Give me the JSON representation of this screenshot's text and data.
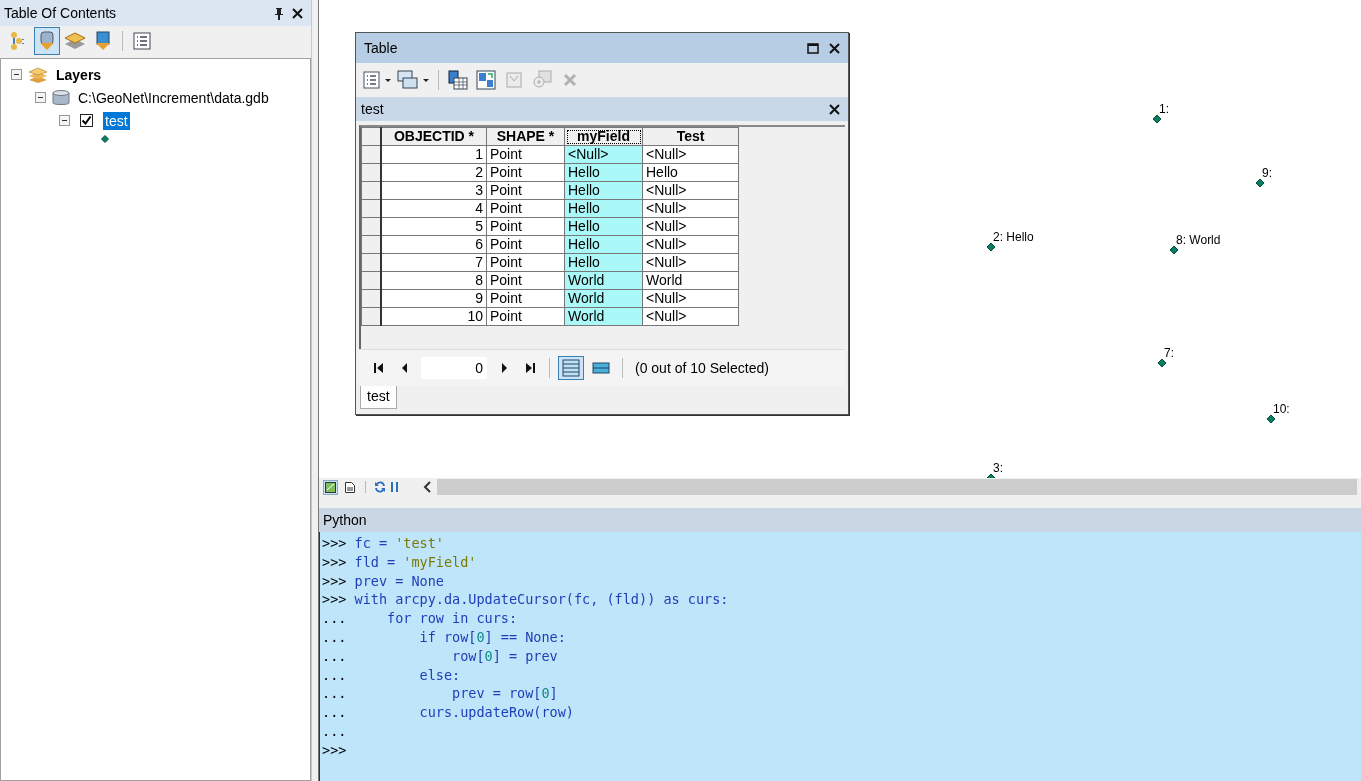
{
  "toc": {
    "title": "Table Of Contents",
    "toolbar": [
      {
        "kind": "drawing-order",
        "selected": false
      },
      {
        "kind": "source",
        "selected": true
      },
      {
        "kind": "visibility",
        "selected": false
      },
      {
        "kind": "selection",
        "selected": false
      },
      {
        "kind": "options",
        "selected": false
      }
    ],
    "tree": [
      {
        "label": "Layers",
        "kind": "frame",
        "expanded": true,
        "children": [
          {
            "label": "C:\\GeoNet\\Increment\\data.gdb",
            "kind": "database",
            "expanded": true,
            "children": [
              {
                "label": "test",
                "kind": "layer",
                "expanded": true,
                "checked": true,
                "selected": true
              }
            ]
          }
        ]
      }
    ]
  },
  "map": {
    "points": [
      {
        "label": "1:"
      },
      {
        "label": "9:"
      },
      {
        "label": "2: Hello"
      },
      {
        "label": "8: World"
      },
      {
        "label": "7:"
      },
      {
        "label": "10:"
      },
      {
        "label": "3:"
      }
    ]
  },
  "table_window": {
    "title": "Table",
    "toolbar": [
      {
        "kind": "options",
        "disabled": false
      },
      {
        "kind": "related",
        "disabled": false
      },
      {
        "kind": "select-by-attributes",
        "disabled": false
      },
      {
        "kind": "switch-selection",
        "disabled": false
      },
      {
        "kind": "clear-selection",
        "disabled": true
      },
      {
        "kind": "zoom-selected",
        "disabled": true
      },
      {
        "kind": "delete",
        "disabled": true
      }
    ],
    "table_name": "test",
    "columns": [
      {
        "label": "OBJECTID *",
        "kind": "number",
        "selected": false
      },
      {
        "label": "SHAPE *",
        "kind": "text",
        "selected": false
      },
      {
        "label": "myField",
        "kind": "text",
        "selected": true
      },
      {
        "label": "Test",
        "kind": "text",
        "selected": false
      }
    ],
    "rows": [
      [
        "1",
        "Point",
        "<Null>",
        "<Null>"
      ],
      [
        "2",
        "Point",
        "Hello",
        "Hello"
      ],
      [
        "3",
        "Point",
        "Hello",
        "<Null>"
      ],
      [
        "4",
        "Point",
        "Hello",
        "<Null>"
      ],
      [
        "5",
        "Point",
        "Hello",
        "<Null>"
      ],
      [
        "6",
        "Point",
        "Hello",
        "<Null>"
      ],
      [
        "7",
        "Point",
        "Hello",
        "<Null>"
      ],
      [
        "8",
        "Point",
        "World",
        "World"
      ],
      [
        "9",
        "Point",
        "World",
        "<Null>"
      ],
      [
        "10",
        "Point",
        "World",
        "<Null>"
      ]
    ],
    "record": "0",
    "views": [
      {
        "kind": "all-records",
        "selected": true
      },
      {
        "kind": "selected-records",
        "selected": false
      }
    ],
    "status": "(0 out of 10 Selected)",
    "tabs": [
      {
        "label": "test",
        "selected": true
      }
    ]
  },
  "map_toolbar": {
    "views": [
      {
        "kind": "layout",
        "selected": true
      },
      {
        "kind": "page",
        "selected": false
      }
    ]
  },
  "python": {
    "title": "Python",
    "lines": [
      {
        "prompt": ">>>",
        "tokens": [
          {
            "kind": "code",
            "text": "fc = "
          },
          {
            "kind": "string",
            "text": "'test'"
          }
        ]
      },
      {
        "prompt": ">>>",
        "tokens": [
          {
            "kind": "code",
            "text": "fld = "
          },
          {
            "kind": "string",
            "text": "'myField'"
          }
        ]
      },
      {
        "prompt": ">>>",
        "tokens": [
          {
            "kind": "code",
            "text": "prev = None"
          }
        ]
      },
      {
        "prompt": ">>>",
        "tokens": [
          {
            "kind": "code",
            "text": "with arcpy.da.UpdateCursor(fc, (fld)) as curs:"
          }
        ]
      },
      {
        "prompt": "...",
        "tokens": [
          {
            "kind": "code",
            "text": "    for row in curs:"
          }
        ]
      },
      {
        "prompt": "...",
        "tokens": [
          {
            "kind": "code",
            "text": "        if row["
          },
          {
            "kind": "number",
            "text": "0"
          },
          {
            "kind": "code",
            "text": "] == None:"
          }
        ]
      },
      {
        "prompt": "...",
        "tokens": [
          {
            "kind": "code",
            "text": "            row["
          },
          {
            "kind": "number",
            "text": "0"
          },
          {
            "kind": "code",
            "text": "] = prev"
          }
        ]
      },
      {
        "prompt": "...",
        "tokens": [
          {
            "kind": "code",
            "text": "        else:"
          }
        ]
      },
      {
        "prompt": "...",
        "tokens": [
          {
            "kind": "code",
            "text": "            prev = row["
          },
          {
            "kind": "number",
            "text": "0"
          },
          {
            "kind": "code",
            "text": "]"
          }
        ]
      },
      {
        "prompt": "...",
        "tokens": [
          {
            "kind": "code",
            "text": "        curs.updateRow(row)"
          }
        ]
      },
      {
        "prompt": "..."
      },
      {
        "prompt": ">>>"
      }
    ]
  }
}
